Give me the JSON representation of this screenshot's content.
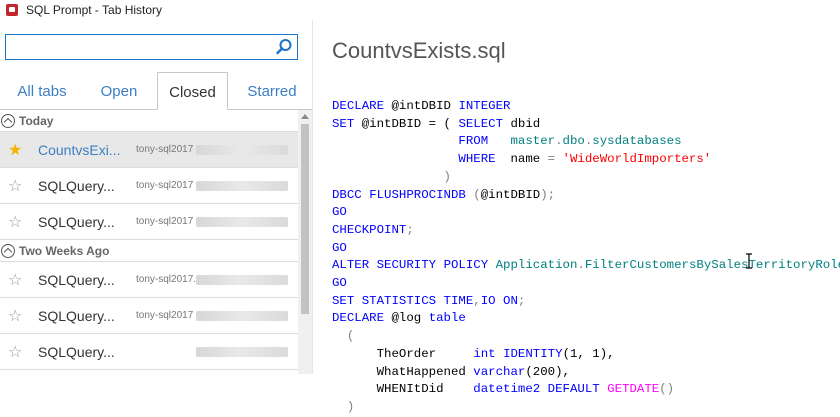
{
  "window": {
    "title": "SQL Prompt - Tab History"
  },
  "search": {
    "value": "",
    "placeholder": ""
  },
  "tabs": [
    {
      "label": "All tabs"
    },
    {
      "label": "Open"
    },
    {
      "label": "Closed"
    },
    {
      "label": "Starred"
    }
  ],
  "groups": [
    {
      "label": "Today",
      "items": [
        {
          "name": "CountvsExi...",
          "server": "tony-sql2017",
          "starred": true,
          "selected": true
        },
        {
          "name": "SQLQuery...",
          "server": "tony-sql2017",
          "starred": false,
          "selected": false
        },
        {
          "name": "SQLQuery...",
          "server": "tony-sql2017",
          "starred": false,
          "selected": false
        }
      ]
    },
    {
      "label": "Two Weeks Ago",
      "items": [
        {
          "name": "SQLQuery...",
          "server": "tony-sql2017.",
          "starred": false,
          "selected": false
        },
        {
          "name": "SQLQuery...",
          "server": "tony-sql2017",
          "starred": false,
          "selected": false
        },
        {
          "name": "SQLQuery...",
          "server": "",
          "starred": false,
          "selected": false
        }
      ]
    }
  ],
  "editor": {
    "file_title": "CountvsExists.sql",
    "code_lines": [
      "DECLARE @intDBID INTEGER",
      "SET @intDBID = ( SELECT dbid",
      "                 FROM   master.dbo.sysdatabases",
      "                 WHERE  name = 'WideWorldImporters'",
      "               )",
      "DBCC FLUSHPROCINDB (@intDBID);",
      "GO",
      "CHECKPOINT;",
      "GO",
      "ALTER SECURITY POLICY Application.FilterCustomersBySalesTerritoryRole",
      "GO",
      "SET STATISTICS TIME,IO ON;",
      "DECLARE @log table",
      "  (",
      "      TheOrder     int IDENTITY(1, 1),",
      "      WhatHappened varchar(200),",
      "      WHENItDid    datetime2 DEFAULT GETDATE()",
      "  )"
    ]
  },
  "colors": {
    "accent": "#3b7fc4",
    "keyword": "#0000ff",
    "function": "#ff00ff",
    "string": "#ff0000",
    "object": "#008080",
    "star_filled": "#f2b400"
  },
  "icons": {
    "app": "sql-prompt-icon",
    "search": "search-icon",
    "star": "star-icon",
    "group_toggle": "chevron-up-circle-icon"
  }
}
